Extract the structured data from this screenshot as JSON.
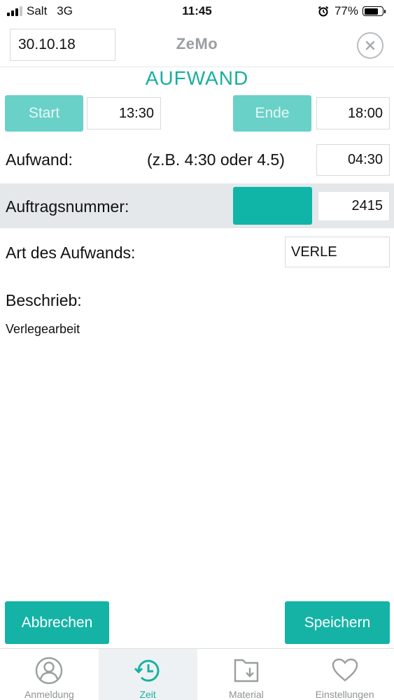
{
  "status_bar": {
    "carrier": "Salt",
    "network": "3G",
    "time": "11:45",
    "battery_percent": "77%",
    "battery_level": 0.77
  },
  "header": {
    "date": "30.10.18",
    "title": "ZeMo"
  },
  "section_title": "AUFWAND",
  "time_row": {
    "start_label": "Start",
    "start_value": "13:30",
    "end_label": "Ende",
    "end_value": "18:00"
  },
  "effort_row": {
    "label": "Aufwand:",
    "hint": "(z.B. 4:30 oder 4.5)",
    "value": "04:30"
  },
  "order_row": {
    "label": "Auftragsnummer:",
    "value": "2415"
  },
  "type_row": {
    "label": "Art des Aufwands:",
    "value": "VERLE"
  },
  "description": {
    "label": "Beschrieb:",
    "value": "Verlegearbeit"
  },
  "actions": {
    "cancel_label": "Abbrechen",
    "save_label": "Speichern"
  },
  "tabs": [
    {
      "label": "Anmeldung",
      "icon": "user-icon",
      "active": false
    },
    {
      "label": "Zeit",
      "icon": "clock-history-icon",
      "active": true
    },
    {
      "label": "Material",
      "icon": "folder-download-icon",
      "active": false
    },
    {
      "label": "Einstellungen",
      "icon": "heart-icon",
      "active": false
    }
  ],
  "colors": {
    "accent": "#15b3a6",
    "accent_light": "#6ad1c8",
    "row_highlight": "#e4e8eb"
  }
}
